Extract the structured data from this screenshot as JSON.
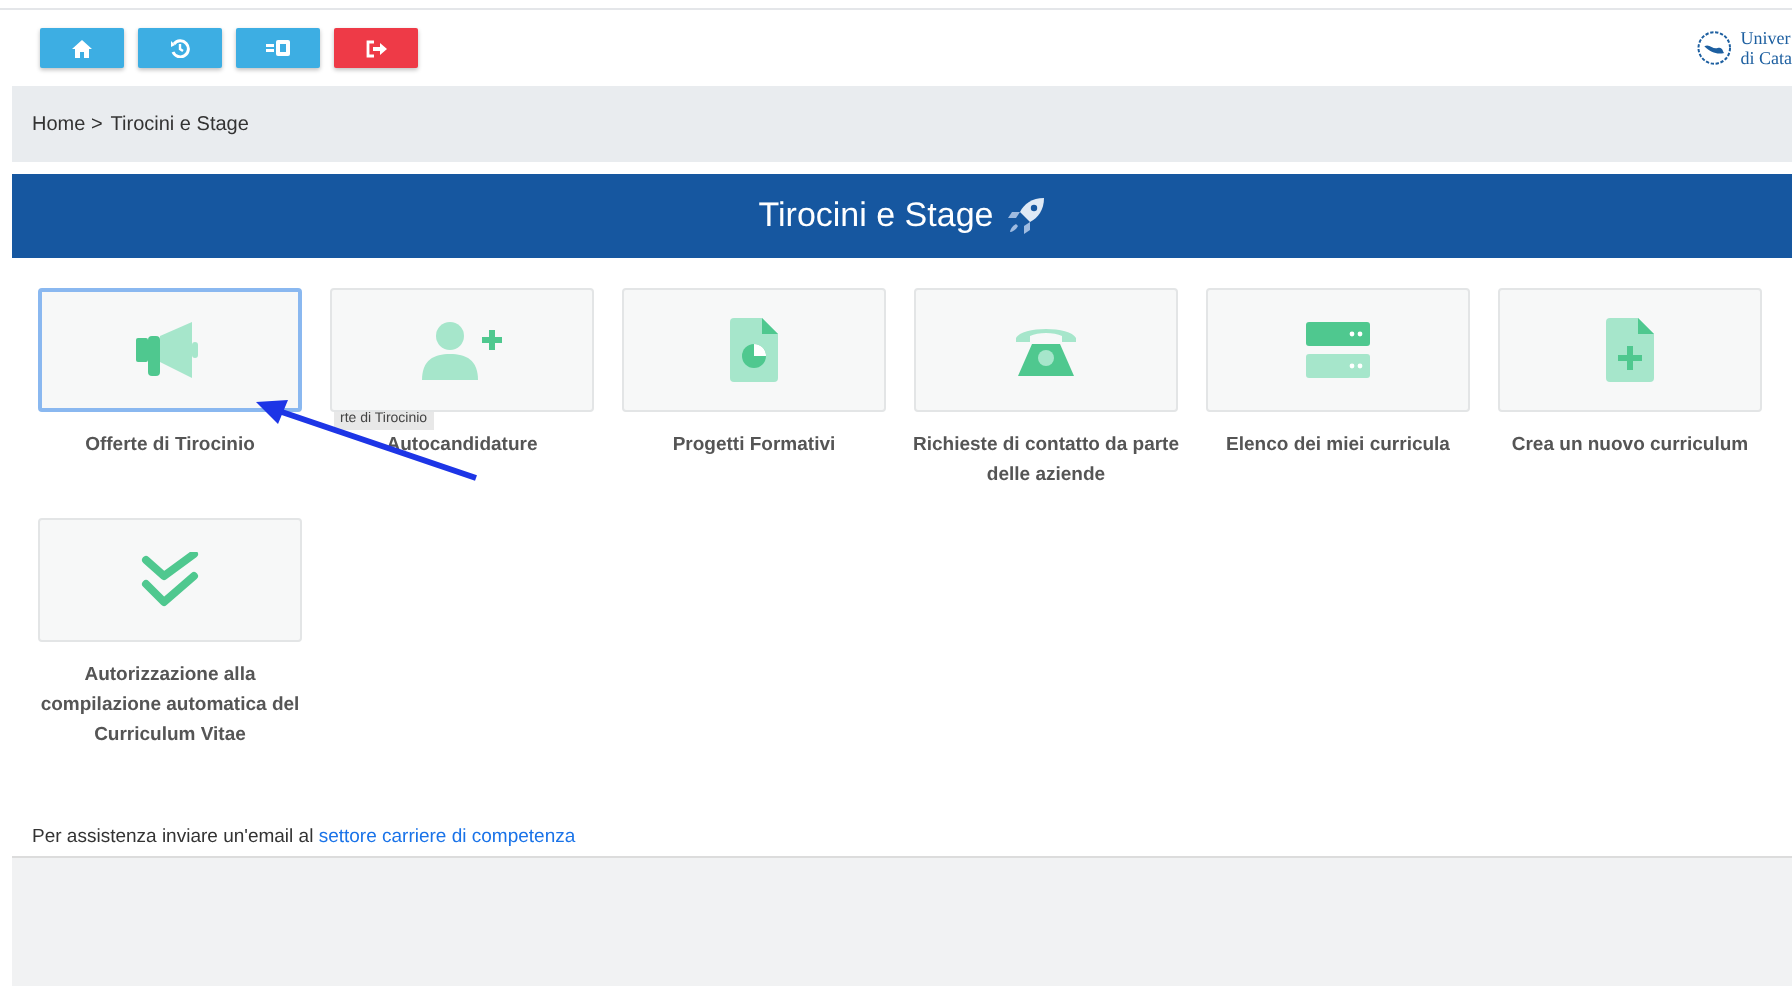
{
  "toolbar": {
    "buttons": [
      {
        "kind": "home"
      },
      {
        "kind": "history"
      },
      {
        "kind": "card"
      },
      {
        "kind": "logout"
      }
    ]
  },
  "logo": {
    "line_1": "Univer",
    "line_2": "di Cata"
  },
  "breadcrumb": {
    "items": [
      "Home >",
      "Tirocini e Stage"
    ]
  },
  "header": {
    "title": "Tirocini e Stage"
  },
  "tiles": [
    {
      "label": "Offerte di Tirocinio",
      "selected": true,
      "tooltip": "rte di Tirocinio"
    },
    {
      "label": "Autocandidature",
      "selected": false
    },
    {
      "label": "Progetti Formativi",
      "selected": false
    },
    {
      "label": "Richieste di contatto da parte delle aziende",
      "selected": false
    },
    {
      "label": "Elenco dei miei curricula",
      "selected": false
    },
    {
      "label": "Crea un nuovo curriculum",
      "selected": false
    },
    {
      "label": "Autorizzazione alla compilazione automatica del Curriculum Vitae",
      "selected": false
    }
  ],
  "footer": {
    "text": "Per assistenza inviare un'email al",
    "link": "settore carriere di competenza"
  }
}
